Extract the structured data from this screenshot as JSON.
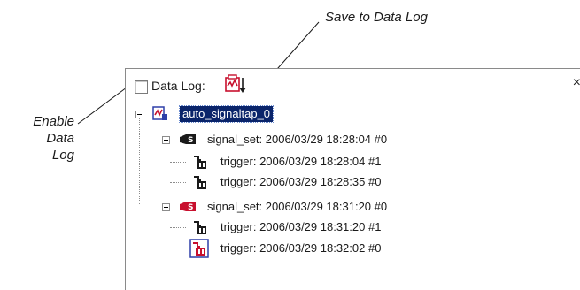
{
  "callouts": {
    "save": "Save to Data Log",
    "enable_line1": "Enable",
    "enable_line2": "Data Log"
  },
  "toolbar": {
    "data_log_label": "Data Log:",
    "data_log_checked": false,
    "save_icon": "save-to-data-log-icon",
    "close_glyph": "×"
  },
  "tree": {
    "root": {
      "label": "auto_signaltap_0",
      "icon": "signaltap-instance-icon",
      "selected": true
    },
    "signal_sets": [
      {
        "label": "signal_set: 2006/03/29 18:28:04  #0",
        "icon": "signal-set-icon",
        "triggers": [
          {
            "label": "trigger: 2006/03/29 18:28:04  #1",
            "icon": "trigger-icon"
          },
          {
            "label": "trigger: 2006/03/29 18:28:35  #0",
            "icon": "trigger-icon"
          }
        ]
      },
      {
        "label": "signal_set: 2006/03/29 18:31:20  #0",
        "icon": "signal-set-active-icon",
        "triggers": [
          {
            "label": "trigger: 2006/03/29 18:31:20  #1",
            "icon": "trigger-icon"
          },
          {
            "label": "trigger: 2006/03/29 18:32:02  #0",
            "icon": "trigger-active-icon"
          }
        ]
      }
    ]
  },
  "colors": {
    "selection": "#0a246a",
    "active_red": "#c8102e",
    "icon_dark": "#1a1a1a",
    "instance_blue": "#2e3fa8"
  }
}
